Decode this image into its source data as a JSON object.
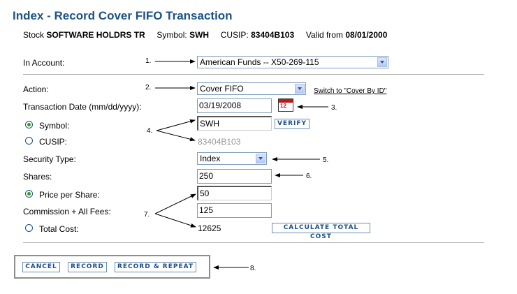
{
  "title": "Index - Record Cover FIFO Transaction",
  "stock": {
    "stock_label": "Stock",
    "stock_name": "SOFTWARE HOLDRS TR",
    "symbol_label": "Symbol:",
    "symbol": "SWH",
    "cusip_label": "CUSIP:",
    "cusip": "83404B103",
    "valid_label": "Valid from",
    "valid_from": "08/01/2000"
  },
  "form": {
    "account_label": "In Account:",
    "account_value": "American Funds -- X50-269-115",
    "action_label": "Action:",
    "action_value": "Cover FIFO",
    "switch_link": "Switch to \"Cover By ID\"",
    "date_label": "Transaction Date (mm/dd/yyyy):",
    "date_value": "03/19/2008",
    "calendar_digits": "12",
    "symbol_label": "Symbol:",
    "symbol_value": "SWH",
    "verify_button": "VERIFY",
    "cusip_label": "CUSIP:",
    "cusip_value": "83404B103",
    "security_type_label": "Security Type:",
    "security_type_value": "Index",
    "shares_label": "Shares:",
    "shares_value": "250",
    "price_label": "Price per Share:",
    "price_value": "50",
    "commission_label": "Commission + All Fees:",
    "commission_value": "125",
    "total_label": "Total Cost:",
    "total_value": "12625",
    "calc_button": "CALCULATE TOTAL COST"
  },
  "buttons": {
    "cancel": "CANCEL",
    "record": "RECORD",
    "record_repeat": "RECORD & REPEAT"
  },
  "callouts": [
    "1.",
    "2.",
    "3.",
    "4.",
    "5.",
    "6.",
    "7.",
    "8."
  ],
  "colors": {
    "title": "#1c5383",
    "button_text": "#1c4f8a",
    "radio_dot": "#2f9a2f",
    "calendar": "#b71c1c"
  }
}
